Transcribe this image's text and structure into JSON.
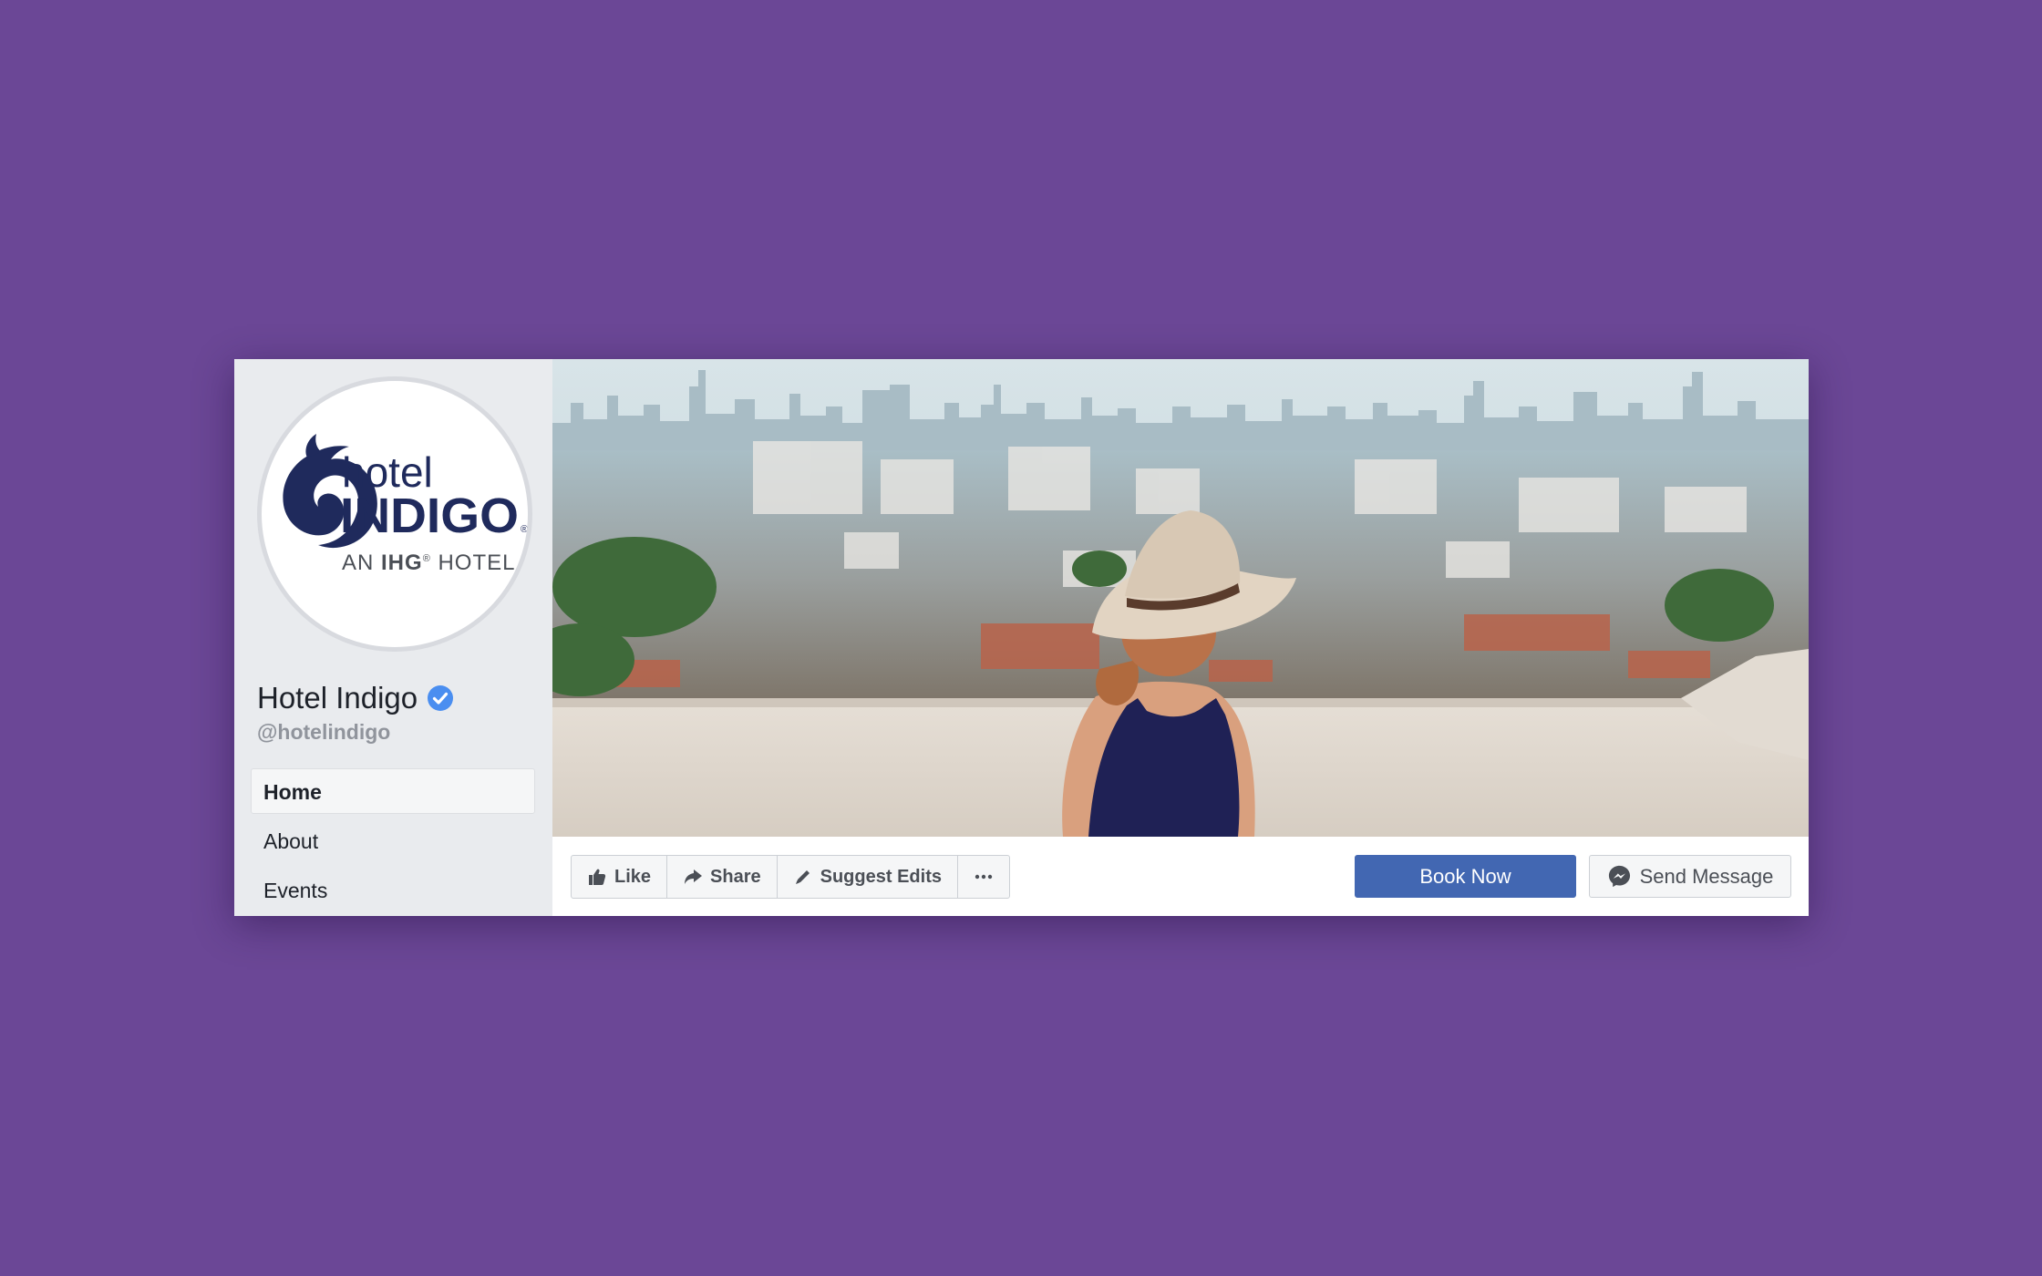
{
  "logo": {
    "line1": "hotel",
    "line2": "INDIGO",
    "tagline_prefix": "AN ",
    "tagline_brand": "IHG",
    "tagline_reg": "®",
    "tagline_suffix": " HOTEL",
    "reg_mark": "®",
    "color": "#1f2a5c"
  },
  "profile": {
    "name": "Hotel Indigo",
    "handle": "@hotelindigo",
    "verified_icon": "verified-badge-icon"
  },
  "nav": {
    "items": [
      {
        "label": "Home"
      },
      {
        "label": "About"
      },
      {
        "label": "Events"
      }
    ]
  },
  "actions": {
    "like": "Like",
    "share": "Share",
    "suggest_edits": "Suggest Edits",
    "book_now": "Book Now",
    "send_message": "Send Message"
  },
  "colors": {
    "background": "#6b4796",
    "primary_button": "#4267b2",
    "verified": "#4a8ef0"
  }
}
